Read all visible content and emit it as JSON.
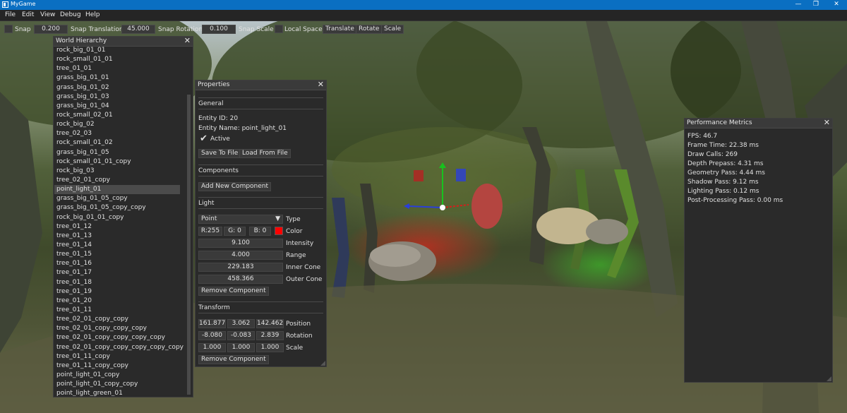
{
  "window": {
    "title": "MyGame",
    "controls": {
      "minimize": "—",
      "maximize": "❐",
      "close": "✕"
    }
  },
  "menu": [
    "File",
    "Edit",
    "View",
    "Debug",
    "Help"
  ],
  "toolbar": {
    "snap_label": "Snap",
    "snap_value": "0.200",
    "snap_translation_label": "Snap Translation",
    "snap_translation_value": "45.000",
    "snap_rotation_label": "Snap Rotation",
    "snap_rotation_value": "0.100",
    "snap_scale_label": "Snap Scale",
    "local_space_label": "Local Space",
    "translate_label": "Translate",
    "rotate_label": "Rotate",
    "scale_label": "Scale"
  },
  "hierarchy": {
    "title": "World Hierarchy",
    "close": "✕",
    "selected_index": 15,
    "items": [
      "rock_big_01_01",
      "rock_small_01_01",
      "tree_01_01",
      "grass_big_01_01",
      "grass_big_01_02",
      "grass_big_01_03",
      "grass_big_01_04",
      "rock_small_02_01",
      "rock_big_02",
      "tree_02_03",
      "rock_small_01_02",
      "grass_big_01_05",
      "rock_small_01_01_copy",
      "rock_big_03",
      "tree_02_01_copy",
      "point_light_01",
      "grass_big_01_05_copy",
      "grass_big_01_05_copy_copy",
      "rock_big_01_01_copy",
      "tree_01_12",
      "tree_01_13",
      "tree_01_14",
      "tree_01_15",
      "tree_01_16",
      "tree_01_17",
      "tree_01_18",
      "tree_01_19",
      "tree_01_20",
      "tree_01_11",
      "tree_02_01_copy_copy",
      "tree_02_01_copy_copy_copy",
      "tree_02_01_copy_copy_copy_copy",
      "tree_02_01_copy_copy_copy_copy_copy",
      "tree_01_11_copy",
      "tree_01_11_copy_copy",
      "point_light_01_copy",
      "point_light_01_copy_copy",
      "point_light_green_01"
    ]
  },
  "properties": {
    "title": "Properties",
    "close": "✕",
    "general": {
      "heading": "General",
      "entity_id": "Entity ID: 20",
      "entity_name": "Entity Name: point_light_01",
      "active_checkmark": "✔",
      "active_label": "Active",
      "save_button": "Save To File",
      "load_button": "Load From File"
    },
    "components": {
      "heading": "Components",
      "add_button": "Add New Component"
    },
    "light": {
      "heading": "Light",
      "type_value": "Point",
      "type_arrow": "▼",
      "type_label": "Type",
      "r": "R:255",
      "g": "G: 0",
      "b": "B: 0",
      "color_label": "Color",
      "color_hex": "#ff0000",
      "intensity": "9.100",
      "intensity_label": "Intensity",
      "range": "4.000",
      "range_label": "Range",
      "inner_cone": "229.183",
      "inner_cone_label": "Inner Cone",
      "outer_cone": "458.366",
      "outer_cone_label": "Outer Cone",
      "remove_button": "Remove Component"
    },
    "transform": {
      "heading": "Transform",
      "position": [
        "161.877",
        "3.062",
        "142.462"
      ],
      "position_label": "Position",
      "rotation": [
        "-8.080",
        "-0.083",
        "2.839"
      ],
      "rotation_label": "Rotation",
      "scale": [
        "1.000",
        "1.000",
        "1.000"
      ],
      "scale_label": "Scale",
      "remove_button": "Remove Component"
    }
  },
  "performance": {
    "title": "Performance Metrics",
    "close": "✕",
    "lines": [
      "FPS: 46.7",
      "Frame Time: 22.38 ms",
      "Draw Calls: 269",
      "Depth Prepass: 4.31 ms",
      "Geometry Pass: 4.44 ms",
      "Shadow Pass: 9.12 ms",
      "Lighting Pass: 0.12 ms",
      "Post-Processing Pass: 0.00 ms"
    ]
  },
  "colors": {
    "titlebar": "#0a6fc2",
    "panel_bg": "#2a2a2a",
    "gizmo_x": "#2a3fd8",
    "gizmo_y": "#18c21e",
    "gizmo_z": "#d81c1c"
  }
}
